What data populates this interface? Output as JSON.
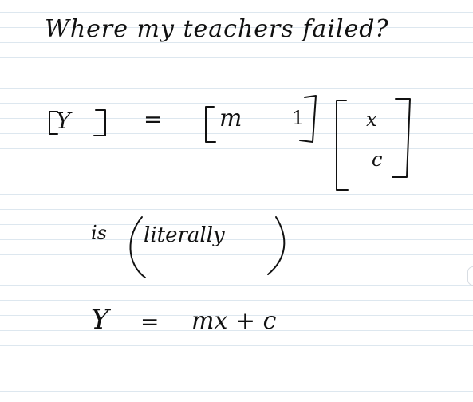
{
  "note": {
    "title": "Where my teachers failed?",
    "matrix_eq": {
      "lhs": "Y",
      "equals": "=",
      "row_m": "m",
      "row_one": "1",
      "col_x": "x",
      "col_c": "c"
    },
    "middle": {
      "is": "is",
      "literally": "literally"
    },
    "final_eq": {
      "lhs": "Y",
      "equals": "=",
      "rhs": "mx + c"
    }
  },
  "colors": {
    "ink": "#111111",
    "rule_line": "#dde7ef",
    "paper": "#ffffff"
  }
}
